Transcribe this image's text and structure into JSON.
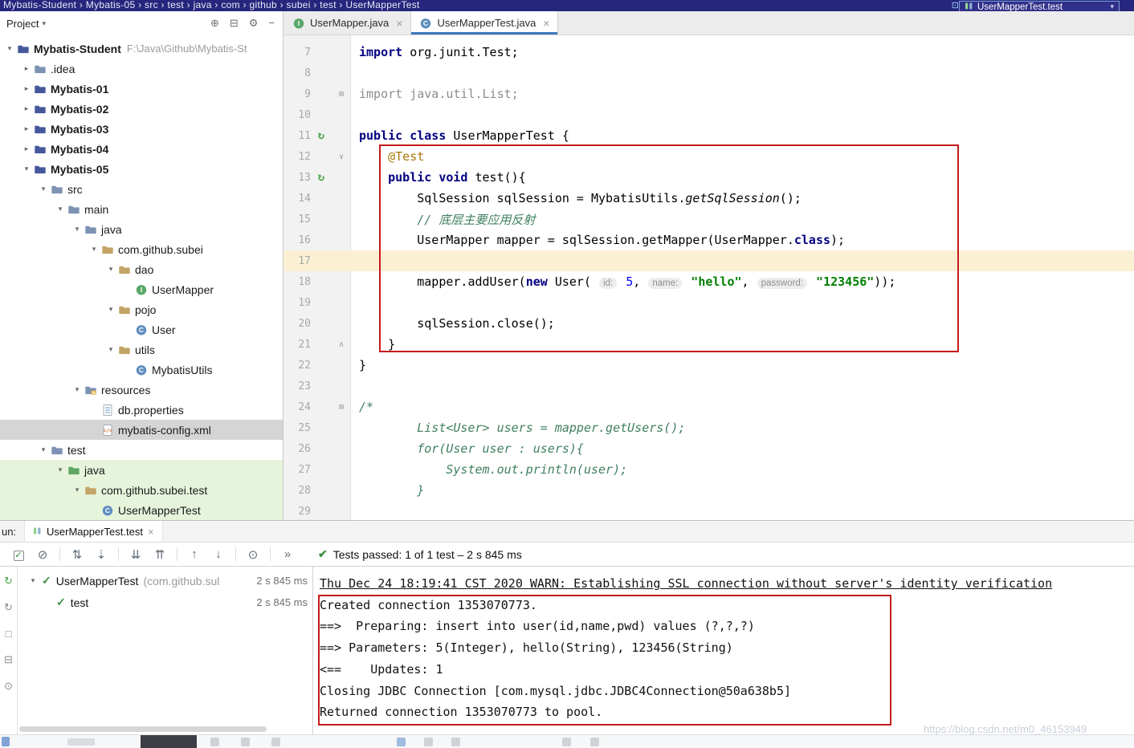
{
  "titlebar": {
    "breadcrumb_items": [
      "Mybatis-Student",
      "Mybatis-05",
      "src",
      "test",
      "java",
      "com",
      "github",
      "subei",
      "test",
      "UserMapperTest"
    ],
    "run_config_label": "UserMapperTest.test"
  },
  "project": {
    "header_label": "Project",
    "header_icons": [
      "locate-file",
      "collapse-all",
      "settings",
      "hide-panel"
    ],
    "tree": [
      {
        "indent": 0,
        "arrow": "expanded",
        "icon": "module-folder",
        "label": "Mybatis-Student",
        "suffix": "F:\\Java\\Github\\Mybatis-St",
        "bold": true
      },
      {
        "indent": 1,
        "arrow": "collapsed",
        "icon": "folder",
        "label": ".idea"
      },
      {
        "indent": 1,
        "arrow": "collapsed",
        "icon": "module-folder",
        "label": "Mybatis-01",
        "bold": true
      },
      {
        "indent": 1,
        "arrow": "collapsed",
        "icon": "module-folder",
        "label": "Mybatis-02",
        "bold": true
      },
      {
        "indent": 1,
        "arrow": "collapsed",
        "icon": "module-folder",
        "label": "Mybatis-03",
        "bold": true
      },
      {
        "indent": 1,
        "arrow": "collapsed",
        "icon": "module-folder",
        "label": "Mybatis-04",
        "bold": true
      },
      {
        "indent": 1,
        "arrow": "expanded",
        "icon": "module-folder",
        "label": "Mybatis-05",
        "bold": true
      },
      {
        "indent": 2,
        "arrow": "expanded",
        "icon": "folder",
        "label": "src"
      },
      {
        "indent": 3,
        "arrow": "expanded",
        "icon": "folder",
        "label": "main"
      },
      {
        "indent": 4,
        "arrow": "expanded",
        "icon": "folder",
        "label": "java"
      },
      {
        "indent": 5,
        "arrow": "expanded",
        "icon": "package",
        "label": "com.github.subei"
      },
      {
        "indent": 6,
        "arrow": "expanded",
        "icon": "package",
        "label": "dao"
      },
      {
        "indent": 7,
        "icon": "interface",
        "label": "UserMapper"
      },
      {
        "indent": 6,
        "arrow": "expanded",
        "icon": "package",
        "label": "pojo"
      },
      {
        "indent": 7,
        "icon": "class",
        "label": "User"
      },
      {
        "indent": 6,
        "arrow": "expanded",
        "icon": "package",
        "label": "utils"
      },
      {
        "indent": 7,
        "icon": "class",
        "label": "MybatisUtils"
      },
      {
        "indent": 4,
        "arrow": "expanded",
        "icon": "resources-folder",
        "label": "resources"
      },
      {
        "indent": 5,
        "icon": "properties-file",
        "label": "db.properties"
      },
      {
        "indent": 5,
        "icon": "xml-file",
        "label": "mybatis-config.xml",
        "selected": true
      },
      {
        "indent": 2,
        "arrow": "expanded",
        "icon": "folder",
        "label": "test"
      },
      {
        "indent": 3,
        "arrow": "expanded",
        "icon": "test-folder",
        "label": "java",
        "scope": "test"
      },
      {
        "indent": 4,
        "arrow": "expanded",
        "icon": "package",
        "label": "com.github.subei.test",
        "scope": "test"
      },
      {
        "indent": 5,
        "icon": "class",
        "label": "UserMapperTest",
        "scope": "test"
      }
    ]
  },
  "editor": {
    "tabs": [
      {
        "icon": "interface",
        "label": "UserMapper.java",
        "active": false
      },
      {
        "icon": "class",
        "label": "UserMapperTest.java",
        "active": true
      }
    ],
    "lines": [
      {
        "n": 7,
        "tokens": [
          [
            "kw",
            "import"
          ],
          [
            "pl",
            " org.junit.Test;"
          ]
        ]
      },
      {
        "n": 8,
        "tokens": []
      },
      {
        "n": 9,
        "fold": "plus",
        "tokens": [
          [
            "gray",
            "import java.util.List;"
          ]
        ]
      },
      {
        "n": 10,
        "tokens": []
      },
      {
        "n": 11,
        "run": true,
        "tokens": [
          [
            "kw",
            "public class"
          ],
          [
            "pl",
            " UserMapperTest {"
          ]
        ]
      },
      {
        "n": 12,
        "fold": "down",
        "tokens": [
          [
            "pl",
            "    "
          ],
          [
            "ann",
            "@Test"
          ]
        ]
      },
      {
        "n": 13,
        "run": true,
        "tokens": [
          [
            "pl",
            "    "
          ],
          [
            "kw",
            "public void"
          ],
          [
            "pl",
            " test(){"
          ]
        ]
      },
      {
        "n": 14,
        "tokens": [
          [
            "pl",
            "        SqlSession sqlSession = MybatisUtils."
          ],
          [
            "sm",
            "getSqlSession"
          ],
          [
            "pl",
            "();"
          ]
        ]
      },
      {
        "n": 15,
        "tokens": [
          [
            "pl",
            "        "
          ],
          [
            "cmt",
            "// 底层主要应用反射"
          ]
        ]
      },
      {
        "n": 16,
        "tokens": [
          [
            "pl",
            "        UserMapper mapper = sqlSession.getMapper(UserMapper."
          ],
          [
            "kw",
            "class"
          ],
          [
            "pl",
            ");"
          ]
        ]
      },
      {
        "n": 17,
        "current": true,
        "tokens": []
      },
      {
        "n": 18,
        "tokens": [
          [
            "pl",
            "        mapper.addUser("
          ],
          [
            "kw",
            "new"
          ],
          [
            "pl",
            " User( "
          ],
          [
            "hint",
            "id:"
          ],
          [
            "num",
            " 5"
          ],
          [
            "pl",
            ", "
          ],
          [
            "hint",
            "name:"
          ],
          [
            "str",
            " \"hello\""
          ],
          [
            "pl",
            ", "
          ],
          [
            "hint",
            "password:"
          ],
          [
            "str",
            " \"123456\""
          ],
          [
            "pl",
            "));"
          ]
        ]
      },
      {
        "n": 19,
        "tokens": []
      },
      {
        "n": 20,
        "tokens": [
          [
            "pl",
            "        sqlSession.close();"
          ]
        ]
      },
      {
        "n": 21,
        "fold": "up",
        "tokens": [
          [
            "pl",
            "    }"
          ]
        ]
      },
      {
        "n": 22,
        "tokens": [
          [
            "pl",
            "}"
          ]
        ]
      },
      {
        "n": 23,
        "tokens": []
      },
      {
        "n": 24,
        "fold": "plus",
        "tokens": [
          [
            "cmt",
            "/*"
          ]
        ]
      },
      {
        "n": 25,
        "tokens": [
          [
            "cmt",
            "        List<User> users = mapper.getUsers();"
          ]
        ]
      },
      {
        "n": 26,
        "tokens": [
          [
            "cmt",
            "        for(User user : users){"
          ]
        ]
      },
      {
        "n": 27,
        "tokens": [
          [
            "cmt",
            "            System.out.println(user);"
          ]
        ]
      },
      {
        "n": 28,
        "tokens": [
          [
            "cmt",
            "        }"
          ]
        ]
      },
      {
        "n": 29,
        "tokens": []
      }
    ]
  },
  "run_panel": {
    "window_label": "un:",
    "tab_label": "UserMapperTest.test",
    "toolbar_icons": [
      "show-passed",
      "show-ignored",
      "sort-alphabetically",
      "sort-by-duration",
      "expand-all",
      "collapse-all",
      "previous-failed-test",
      "next-failed-test",
      "test-history",
      "more-options"
    ],
    "side_icons": [
      "rerun-test",
      "rerun-failed-tests",
      "stop-process",
      "restore-layout",
      "pin-tab"
    ],
    "status_text": "Tests passed: 1 of 1 test – 2 s 845 ms",
    "tree": [
      {
        "indent": 0,
        "expanded": true,
        "name": "UserMapperTest",
        "suffix": "(com.github.sul",
        "time": "2 s 845 ms"
      },
      {
        "indent": 1,
        "name": "test",
        "time": "2 s 845 ms"
      }
    ],
    "console": [
      {
        "text": "Thu Dec 24 18:19:41 CST 2020 WARN: Establishing SSL connection without server's identity verification",
        "underline": true
      },
      {
        "text": "Created connection 1353070773."
      },
      {
        "text": "==>  Preparing: insert into user(id,name,pwd) values (?,?,?)"
      },
      {
        "text": "==> Parameters: 5(Integer), hello(String), 123456(String)"
      },
      {
        "text": "<==    Updates: 1"
      },
      {
        "text": "Closing JDBC Connection [com.mysql.jdbc.JDBC4Connection@50a638b5]"
      },
      {
        "text": "Returned connection 1353070773 to pool."
      }
    ]
  },
  "watermark": "https://blog.csdn.net/m0_46153949",
  "colors": {
    "annotation_red": "#C41A1A",
    "test_pass_green": "#3E9141",
    "titlebar_blue": "#26267E",
    "selection_gray": "#D5D5D5",
    "test_scope_green": "#E6F4DC",
    "current_line": "#FBF0D3"
  }
}
